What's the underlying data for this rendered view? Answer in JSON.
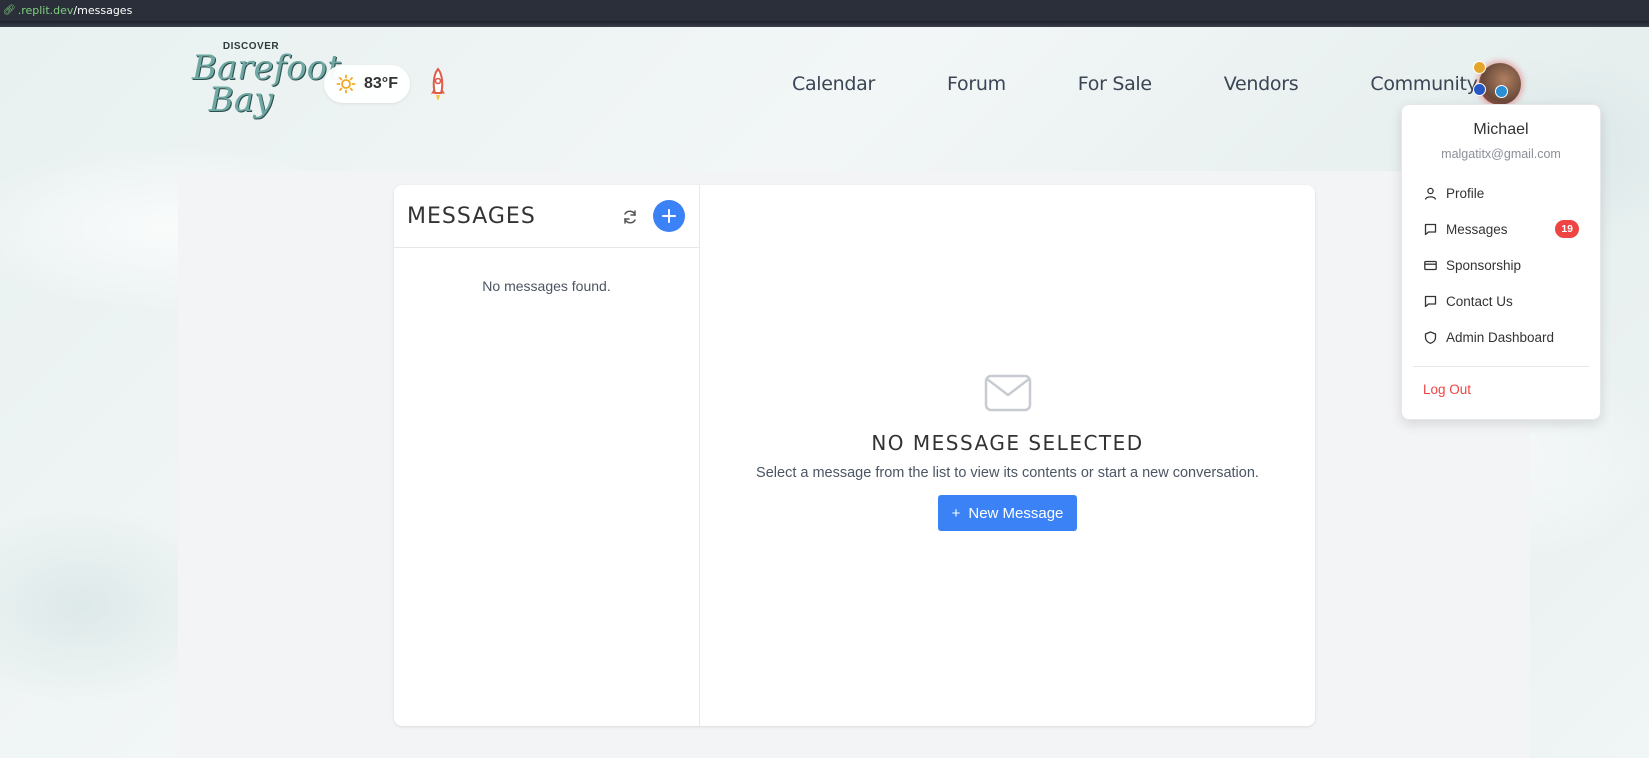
{
  "browser": {
    "url_host": ".replit.dev",
    "url_path": "/messages"
  },
  "header": {
    "logo_top": "DISCOVER",
    "logo_line1": "Barefoot",
    "logo_line2": "Bay",
    "weather_temp": "83°F",
    "nav": [
      {
        "label": "Calendar"
      },
      {
        "label": "Forum"
      },
      {
        "label": "For Sale"
      },
      {
        "label": "Vendors"
      },
      {
        "label": "Community"
      }
    ]
  },
  "messages_pane": {
    "title": "MESSAGES",
    "empty_text": "No messages found."
  },
  "detail_pane": {
    "heading": "NO MESSAGE SELECTED",
    "description": "Select a message from the list to view its contents or start a new conversation.",
    "button_plus": "+",
    "button_label": "New Message"
  },
  "user_menu": {
    "name": "Michael",
    "email": "malgatitx@gmail.com",
    "items": [
      {
        "label": "Profile",
        "icon": "user-icon"
      },
      {
        "label": "Messages",
        "icon": "message-icon",
        "badge": "19"
      },
      {
        "label": "Sponsorship",
        "icon": "credit-card-icon"
      },
      {
        "label": "Contact Us",
        "icon": "message-icon"
      },
      {
        "label": "Admin Dashboard",
        "icon": "shield-icon"
      }
    ],
    "logout_label": "Log Out"
  },
  "colors": {
    "accent_blue": "#3b82f6",
    "badge_red": "#ef4444",
    "logout_red": "#ef4444"
  }
}
